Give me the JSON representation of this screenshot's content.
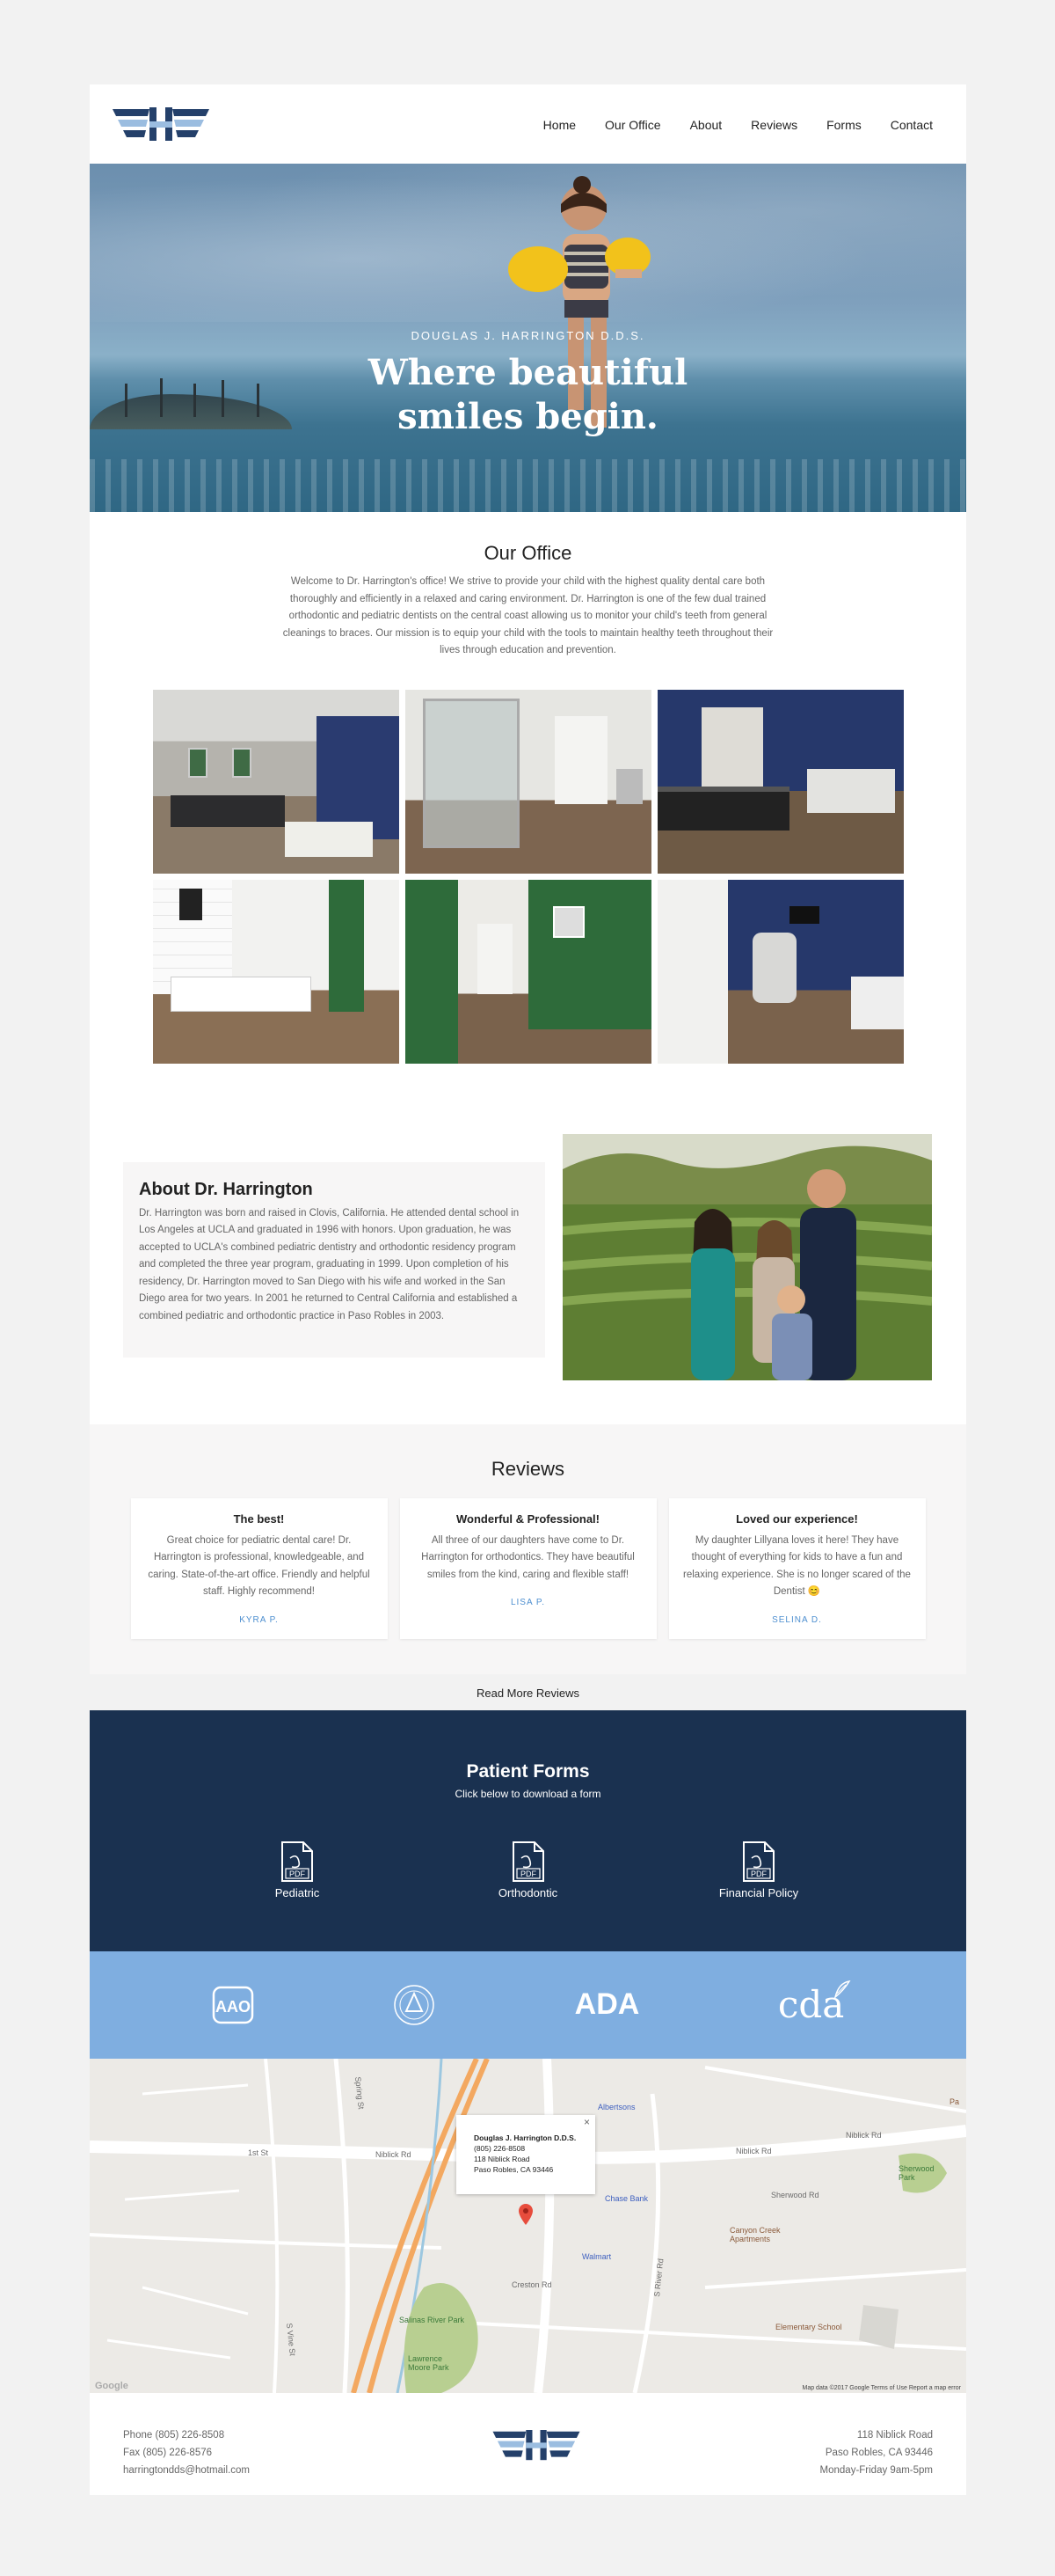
{
  "header": {
    "nav": [
      "Home",
      "Our Office",
      "About",
      "Reviews",
      "Forms",
      "Contact"
    ]
  },
  "hero": {
    "subtitle": "DOUGLAS J. HARRINGTON D.D.S.",
    "title_line1": "Where beautiful",
    "title_line2": "smiles begin."
  },
  "office": {
    "title": "Our Office",
    "text": "Welcome to Dr. Harrington's office! We strive to provide your child with the highest quality dental care both thoroughly and efficiently in a relaxed and caring environment. Dr. Harrington is one of the few dual trained orthodontic and pediatric dentists on the central coast allowing us to monitor your child's teeth from general cleanings to braces. Our mission is to equip your child with the tools to maintain healthy teeth throughout their lives through education and prevention."
  },
  "about": {
    "title": "About Dr. Harrington",
    "text": "Dr. Harrington was born and raised in Clovis, California. He attended dental school in Los Angeles at UCLA and graduated in 1996 with honors. Upon graduation, he was accepted to UCLA's combined pediatric dentistry and orthodontic residency program and completed the three year program, graduating in 1999. Upon completion of his residency, Dr. Harrington moved to San Diego with his wife and worked in the San Diego area for two years. In 2001 he returned to Central California and established a combined pediatric and orthodontic practice in Paso Robles in 2003."
  },
  "reviews": {
    "title": "Reviews",
    "items": [
      {
        "title": "The best!",
        "text": "Great choice for pediatric dental care! Dr. Harrington is professional, knowledgeable, and caring. State-of-the-art office. Friendly and helpful staff. Highly recommend!",
        "name": "KYRA P."
      },
      {
        "title": "Wonderful & Professional!",
        "text": "All three of our daughters have come to Dr. Harrington for orthodontics. They have beautiful smiles from the kind, caring and flexible staff!",
        "name": "LISA P."
      },
      {
        "title": "Loved our experience!",
        "text": "My daughter Lillyana loves it here! They have thought of everything for kids to have a fun and relaxing experience. She is no longer scared of the Dentist 😊",
        "name": "SELINA D."
      }
    ],
    "read_more": "Read More Reviews"
  },
  "forms": {
    "title": "Patient Forms",
    "subtitle": "Click below to download a form",
    "pdf_label": "PDF",
    "items": [
      "Pediatric",
      "Orthodontic",
      "Financial Policy"
    ]
  },
  "affiliations": {
    "aao": "AAO",
    "ada": "ADA",
    "cda": "cda"
  },
  "map": {
    "info_name": "Douglas J. Harrington D.D.S.",
    "info_phone": "(805) 226-8508",
    "info_street": "118 Niblick Road",
    "info_city": "Paso Robles, CA 93446",
    "close": "×",
    "labels": {
      "niblick_left": "Niblick Rd",
      "niblick_right": "Niblick Rd",
      "niblick_far": "Niblick Rd",
      "first_st": "1st St",
      "spring_st": "Spring St",
      "s_vine": "S Vine St",
      "s_river": "S River Rd",
      "sherwood": "Sherwood Rd",
      "creston": "Creston Rd"
    },
    "pois": {
      "albertsons": "Albertsons",
      "chase": "Chase Bank",
      "walmart": "Walmart",
      "canyon_creek": "Canyon Creek Apartments",
      "elementary": "Elementary School",
      "salinas": "Salinas River Park",
      "sherwood_park": "Sherwood Park",
      "lawrence": "Lawrence Moore Park",
      "pa": "Pa"
    },
    "footer": "Map data ©2017 Google   Terms of Use   Report a map error",
    "google": "Google"
  },
  "footer": {
    "phone": "Phone (805) 226-8508",
    "fax": "Fax (805) 226-8576",
    "email": "harringtondds@hotmail.com",
    "street": "118 Niblick Road",
    "city": "Paso Robles, CA 93446",
    "hours": "Monday-Friday 9am-5pm"
  },
  "colors": {
    "navy": "#1a3150",
    "light_blue": "#7faee0",
    "link_blue": "#4e8fd0",
    "logo_dark": "#24406a",
    "logo_light": "#9bbde0"
  }
}
